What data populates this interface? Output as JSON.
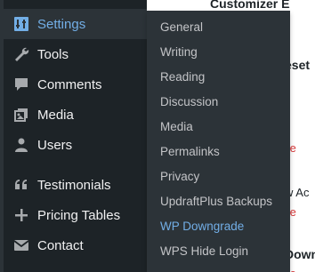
{
  "sidebar": {
    "items": [
      {
        "label": "Settings",
        "icon": "settings-icon"
      },
      {
        "label": "Tools",
        "icon": "wrench-icon"
      },
      {
        "label": "Comments",
        "icon": "comment-icon"
      },
      {
        "label": "Media",
        "icon": "media-icon"
      },
      {
        "label": "Users",
        "icon": "users-icon"
      },
      {
        "label": "Testimonials",
        "icon": "quote-icon"
      },
      {
        "label": "Pricing Tables",
        "icon": "plus-icon"
      },
      {
        "label": "Contact",
        "icon": "envelope-icon"
      }
    ]
  },
  "submenu": {
    "items": [
      {
        "label": "General"
      },
      {
        "label": "Writing"
      },
      {
        "label": "Reading"
      },
      {
        "label": "Discussion"
      },
      {
        "label": "Media"
      },
      {
        "label": "Permalinks"
      },
      {
        "label": "Privacy"
      },
      {
        "label": "UpdraftPlus Backups"
      },
      {
        "label": "WP Downgrade"
      },
      {
        "label": "WPS Hide Login"
      }
    ]
  },
  "background": {
    "heading": "Customizer Export",
    "fragments": [
      "eset",
      "te",
      "w Ac",
      "te",
      "Down",
      "te"
    ]
  },
  "colors": {
    "sidebar_bg": "#1d2327",
    "submenu_bg": "#2c3338",
    "accent": "#72aee6",
    "text": "#f0f0f1",
    "delete_red": "#d63638"
  }
}
